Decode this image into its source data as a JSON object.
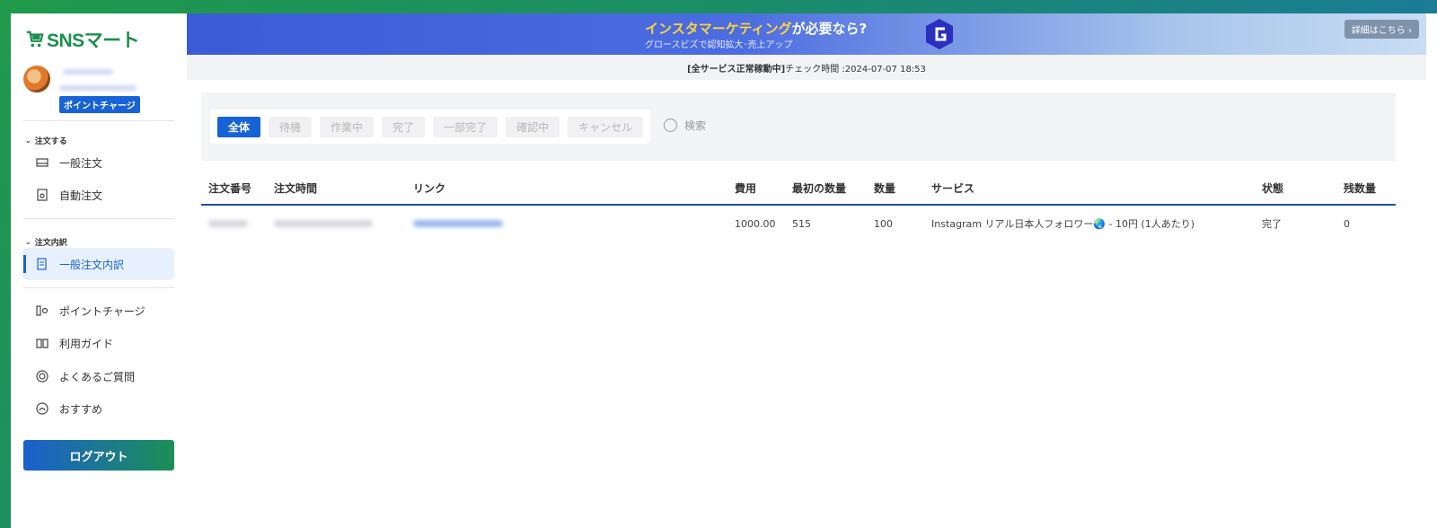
{
  "logo": {
    "text": "SNSマート"
  },
  "user": {
    "charge_label": "ポイントチャージ"
  },
  "sidebar": {
    "group_order": "注文する",
    "general_order": "一般注文",
    "auto_order": "自動注文",
    "group_history": "注文内訳",
    "general_history": "一般注文内訳",
    "point_charge": "ポイントチャージ",
    "guide": "利用ガイド",
    "faq": "よくあるご質問",
    "recommend": "おすすめ",
    "logout": "ログアウト"
  },
  "banner": {
    "title_highlight": "インスタマーケティング",
    "title_rest": "が必要なら?",
    "subtitle": "グロースビズで認知拡大･売上アップ",
    "detail_button": "詳細はこちら ›"
  },
  "status": {
    "bold": "[全サービス正常稼動中]",
    "text": "チェック時間 :2024-07-07 18:53"
  },
  "filters": {
    "tabs": [
      "全体",
      "待機",
      "作業中",
      "完了",
      "一部完了",
      "確認中",
      "キャンセル"
    ],
    "active": "全体",
    "search_label": "検索"
  },
  "table": {
    "headers": [
      "注文番号",
      "注文時間",
      "リンク",
      "費用",
      "最初の数量",
      "数量",
      "サービス",
      "状態",
      "残数量"
    ],
    "rows": [
      {
        "cost": "1000.00",
        "initial_qty": "515",
        "qty": "100",
        "service": "Instagram リアル日本人フォロワー🌏 - 10円 (1人あたり)",
        "status": "完了",
        "remaining": "0"
      }
    ]
  },
  "colors": {
    "brand_green": "#1a8f4e",
    "accent_blue": "#1763d6"
  }
}
